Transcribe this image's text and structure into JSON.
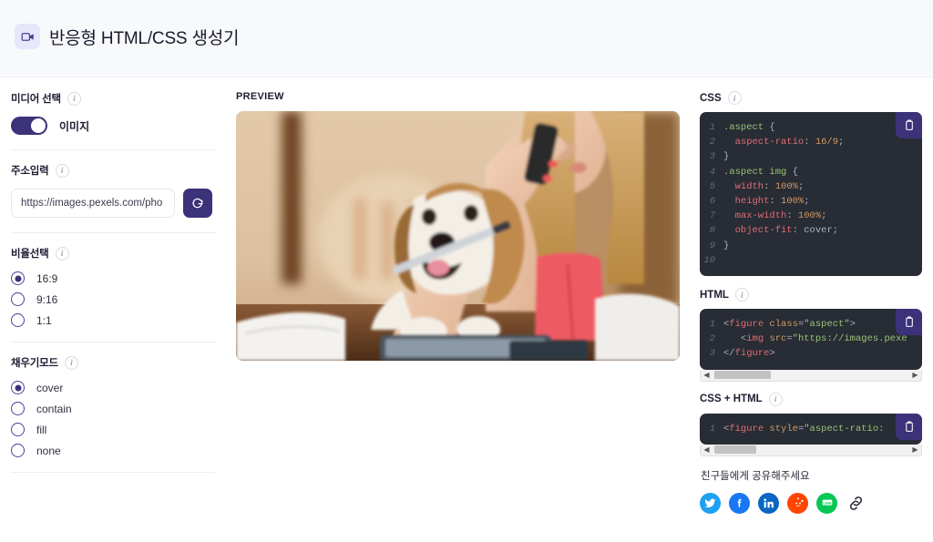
{
  "header": {
    "title": "반응형 HTML/CSS 생성기",
    "logo_icon": "video-camera-icon",
    "logo_bg": "#e7e6fb"
  },
  "sidebar": {
    "media_select": {
      "label": "미디어 선택",
      "info_icon": "info-icon",
      "toggle_on": true,
      "toggle_label": "이미지"
    },
    "url_input": {
      "label": "주소입력",
      "info_icon": "info-icon",
      "value": "https://images.pexels.com/pho",
      "placeholder": "https://images.pexels.com/pho",
      "refresh_icon": "refresh-icon"
    },
    "ratio_select": {
      "label": "비율선택",
      "info_icon": "info-icon",
      "options": [
        {
          "label": "16:9",
          "selected": true
        },
        {
          "label": "9:16",
          "selected": false
        },
        {
          "label": "1:1",
          "selected": false
        }
      ]
    },
    "fill_mode": {
      "label": "채우기모드",
      "info_icon": "info-icon",
      "options": [
        {
          "label": "cover",
          "selected": true
        },
        {
          "label": "contain",
          "selected": false
        },
        {
          "label": "fill",
          "selected": false
        },
        {
          "label": "none",
          "selected": false
        }
      ]
    }
  },
  "preview": {
    "label": "PREVIEW",
    "image_description": "woman on phone with beagle dog holding pen at desk"
  },
  "panels": {
    "css": {
      "label": "CSS",
      "info_icon": "info-icon",
      "copy_icon": "clipboard-icon",
      "lines": [
        {
          "n": "1",
          "segs": [
            {
              "t": ".aspect ",
              "c": "sel"
            },
            {
              "t": "{",
              "c": "ct"
            }
          ]
        },
        {
          "n": "2",
          "segs": [
            {
              "t": "  aspect-ratio",
              "c": "prop"
            },
            {
              "t": ": ",
              "c": "ct"
            },
            {
              "t": "16/9",
              "c": "val"
            },
            {
              "t": ";",
              "c": "ct"
            }
          ]
        },
        {
          "n": "3",
          "segs": [
            {
              "t": "}",
              "c": "ct"
            }
          ]
        },
        {
          "n": "4",
          "segs": [
            {
              "t": ".aspect img ",
              "c": "sel"
            },
            {
              "t": "{",
              "c": "ct"
            }
          ]
        },
        {
          "n": "5",
          "segs": [
            {
              "t": "  width",
              "c": "prop"
            },
            {
              "t": ": ",
              "c": "ct"
            },
            {
              "t": "100%",
              "c": "val"
            },
            {
              "t": ";",
              "c": "ct"
            }
          ]
        },
        {
          "n": "6",
          "segs": [
            {
              "t": "  height",
              "c": "prop"
            },
            {
              "t": ": ",
              "c": "ct"
            },
            {
              "t": "100%",
              "c": "val"
            },
            {
              "t": ";",
              "c": "ct"
            }
          ]
        },
        {
          "n": "7",
          "segs": [
            {
              "t": "  max-width",
              "c": "prop"
            },
            {
              "t": ": ",
              "c": "ct"
            },
            {
              "t": "100%",
              "c": "val"
            },
            {
              "t": ";",
              "c": "ct"
            }
          ]
        },
        {
          "n": "8",
          "segs": [
            {
              "t": "  object-fit",
              "c": "prop"
            },
            {
              "t": ": ",
              "c": "ct"
            },
            {
              "t": "cover",
              "c": "ct"
            },
            {
              "t": ";",
              "c": "ct"
            }
          ]
        },
        {
          "n": "9",
          "segs": [
            {
              "t": "}",
              "c": "ct"
            }
          ]
        },
        {
          "n": "10",
          "segs": [
            {
              "t": "",
              "c": "ct"
            }
          ]
        }
      ]
    },
    "html": {
      "label": "HTML",
      "info_icon": "info-icon",
      "copy_icon": "clipboard-icon",
      "lines": [
        {
          "n": "1",
          "segs": [
            {
              "t": "<",
              "c": "punc"
            },
            {
              "t": "figure ",
              "c": "tag"
            },
            {
              "t": "class",
              "c": "attr"
            },
            {
              "t": "=",
              "c": "ct"
            },
            {
              "t": "\"aspect\"",
              "c": "str"
            },
            {
              "t": ">",
              "c": "punc"
            }
          ]
        },
        {
          "n": "2",
          "segs": [
            {
              "t": "   <",
              "c": "punc"
            },
            {
              "t": "img ",
              "c": "tag"
            },
            {
              "t": "src",
              "c": "attr"
            },
            {
              "t": "=",
              "c": "ct"
            },
            {
              "t": "\"https://images.pexe",
              "c": "str"
            }
          ]
        },
        {
          "n": "3",
          "segs": [
            {
              "t": "</",
              "c": "punc"
            },
            {
              "t": "figure",
              "c": "tag"
            },
            {
              "t": ">",
              "c": "punc"
            }
          ]
        }
      ],
      "has_scrollbar": true
    },
    "css_html": {
      "label": "CSS + HTML",
      "info_icon": "info-icon",
      "copy_icon": "clipboard-icon",
      "lines": [
        {
          "n": "1",
          "segs": [
            {
              "t": "<",
              "c": "punc"
            },
            {
              "t": "figure ",
              "c": "tag"
            },
            {
              "t": "style",
              "c": "attr"
            },
            {
              "t": "=",
              "c": "ct"
            },
            {
              "t": "\"aspect-ratio:",
              "c": "str"
            }
          ]
        }
      ],
      "has_scrollbar": true
    }
  },
  "share": {
    "title": "친구들에게 공유해주세요",
    "items": [
      {
        "name": "twitter",
        "color": "#1da1f2"
      },
      {
        "name": "facebook",
        "color": "#1877f2"
      },
      {
        "name": "linkedin",
        "color": "#0a66c2"
      },
      {
        "name": "reddit",
        "color": "#ff4500"
      },
      {
        "name": "line",
        "color": "#06c755"
      },
      {
        "name": "copy-link",
        "color": "#2b2b3d"
      }
    ]
  }
}
